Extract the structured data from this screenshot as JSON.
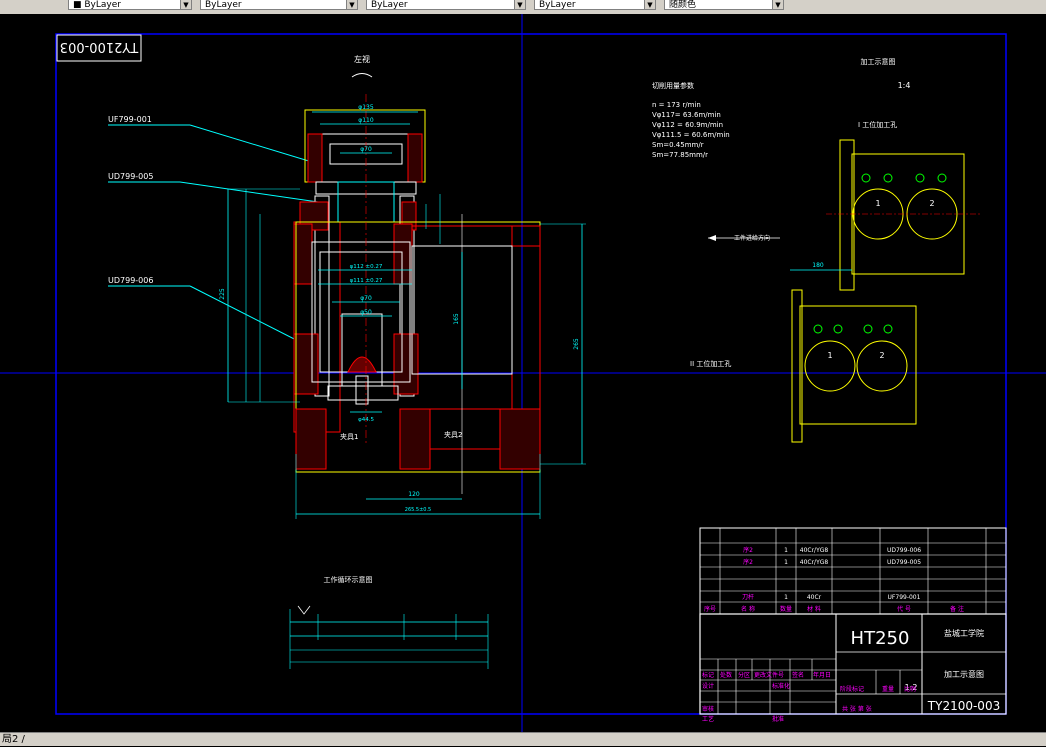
{
  "toolbar": {
    "combos": [
      {
        "value": "■ ByLayer"
      },
      {
        "value": "ByLayer"
      },
      {
        "value": "ByLayer"
      },
      {
        "value": "ByLayer"
      },
      {
        "value": "随颜色"
      }
    ]
  },
  "drawing": {
    "stamp": "TY2100-003",
    "top_view_label": "左视",
    "part_labels": [
      "UF799-001",
      "UD799-005",
      "UD799-006"
    ],
    "dims": {
      "d135": "φ135",
      "d110": "φ110",
      "d70a": "φ70",
      "d112": "φ112 ±0.27",
      "d111": "φ111 ±0.27",
      "d70b": "φ70",
      "d50": "φ50",
      "d445": "φ44.5",
      "w120": "120",
      "w265": "265.5±0.5",
      "h165": "165",
      "h265": "265",
      "h225": "225"
    },
    "cut_params_title": "切削用量参数",
    "cut_params": [
      "n = 173 r/min",
      "Vφ117= 63.6m/min",
      "Vφ112 = 60.9m/min",
      "Vφ111.5 = 60.6m/min",
      "Sm=0.45mm/r",
      "Sm=77.85mm/r"
    ],
    "process_title": "加工示意图",
    "scale_note": "1:4",
    "station1": "I 工位加工孔",
    "station2": "II 工位加工孔",
    "feed_dir": "工件进给方向",
    "dim_180": "180",
    "hole1": "1",
    "hole2": "2",
    "cycle_title": "工作循环示意图",
    "fixture1": "夹具1",
    "fixture2": "夹具2"
  },
  "title_block": {
    "bom_rows": [
      {
        "num": "序2",
        "qty": "1",
        "mat": "40Cr/YG8",
        "code": "UD799-006"
      },
      {
        "num": "序2",
        "qty": "1",
        "mat": "40Cr/YG8",
        "code": "UD799-005"
      },
      {
        "num": "",
        "qty": "",
        "mat": "",
        "code": ""
      },
      {
        "num": "",
        "qty": "",
        "mat": "",
        "code": ""
      },
      {
        "num": "刀杆",
        "qty": "1",
        "mat": "40Cr",
        "code": "UF799-001"
      }
    ],
    "bom_header": [
      "序号",
      "名 称",
      "数量",
      "材 料",
      "代 号",
      "备 注"
    ],
    "material": "HT250",
    "school": "盐城工学院",
    "drawing_name": "加工示意图",
    "drawing_no": "TY2100-003",
    "scale": "1:2",
    "labels": {
      "mark": "标记",
      "count": "处数",
      "zone": "分区",
      "change_doc": "更改文件号",
      "sign": "签名",
      "date": "年月日",
      "design": "设计",
      "standard": "标准化",
      "review": "审核",
      "process": "工艺",
      "approve": "批准",
      "stage": "阶段标记",
      "weight": "重量",
      "ratio": "比例",
      "sheets": "共 张 第 张"
    }
  },
  "status": {
    "layout_tab": "局2 /"
  },
  "colors": {
    "cyan": "#00ffff",
    "yellow": "#ffff00",
    "red": "#ff0000",
    "white": "#ffffff",
    "magenta": "#ff00ff",
    "blue": "#0000ff",
    "green": "#00ff00"
  }
}
